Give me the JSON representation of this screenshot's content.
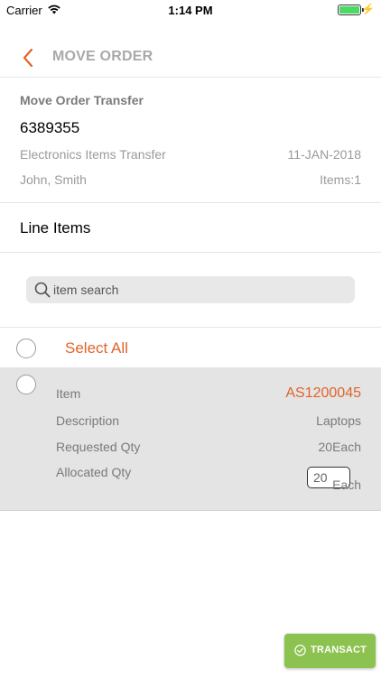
{
  "status_bar": {
    "carrier": "Carrier",
    "time": "1:14 PM",
    "battery_level": 1.0,
    "icons": [
      "wifi-icon",
      "battery-icon",
      "charging-icon"
    ]
  },
  "nav": {
    "title": "MOVE ORDER",
    "back_icon": "chevron-left-icon",
    "accent_color": "#e0642a"
  },
  "order": {
    "heading": "Move Order Transfer",
    "number": "6389355",
    "description": "Electronics Items Transfer",
    "date": "11-JAN-2018",
    "requester": "John, Smith",
    "items_count": "Items:1"
  },
  "line_items": {
    "heading": "Line Items",
    "search_placeholder": "item search",
    "select_all_label": "Select All",
    "items": [
      {
        "item_label": "Item",
        "item_value": "AS1200045",
        "description_label": "Description",
        "description_value": "Laptops",
        "requested_label": "Requested Qty",
        "requested_value": "20Each",
        "allocated_label": "Allocated Qty",
        "allocated_value": "20",
        "allocated_unit": "Each"
      }
    ]
  },
  "actions": {
    "transact_label": "TRANSACT",
    "transact_color": "#8cc24f"
  }
}
